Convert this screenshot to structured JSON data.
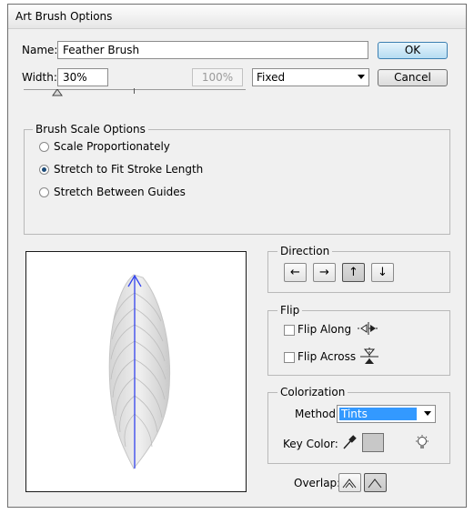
{
  "window": {
    "title": "Art Brush Options"
  },
  "name_field": {
    "label": "Name:",
    "value": "Feather Brush"
  },
  "width_field": {
    "label": "Width:",
    "value": "30%",
    "disabled_value": "100%"
  },
  "width_mode": {
    "selected": "Fixed"
  },
  "buttons": {
    "ok": "OK",
    "cancel": "Cancel"
  },
  "scale_options": {
    "title": "Brush Scale Options",
    "options": [
      "Scale Proportionately",
      "Stretch to Fit Stroke Length",
      "Stretch Between Guides"
    ],
    "selected": 1
  },
  "direction": {
    "title": "Direction",
    "buttons": [
      "←",
      "→",
      "↑",
      "↓"
    ],
    "selected": 2
  },
  "flip": {
    "title": "Flip",
    "along": "Flip Along",
    "across": "Flip Across"
  },
  "colorization": {
    "title": "Colorization",
    "method_label": "Method:",
    "method_value": "Tints",
    "key_color_label": "Key Color:",
    "key_color": "#c8c8c8"
  },
  "overlap": {
    "label": "Overlap:"
  },
  "colors": {
    "accent": "#3399ff",
    "direction_line": "#3344ee"
  }
}
